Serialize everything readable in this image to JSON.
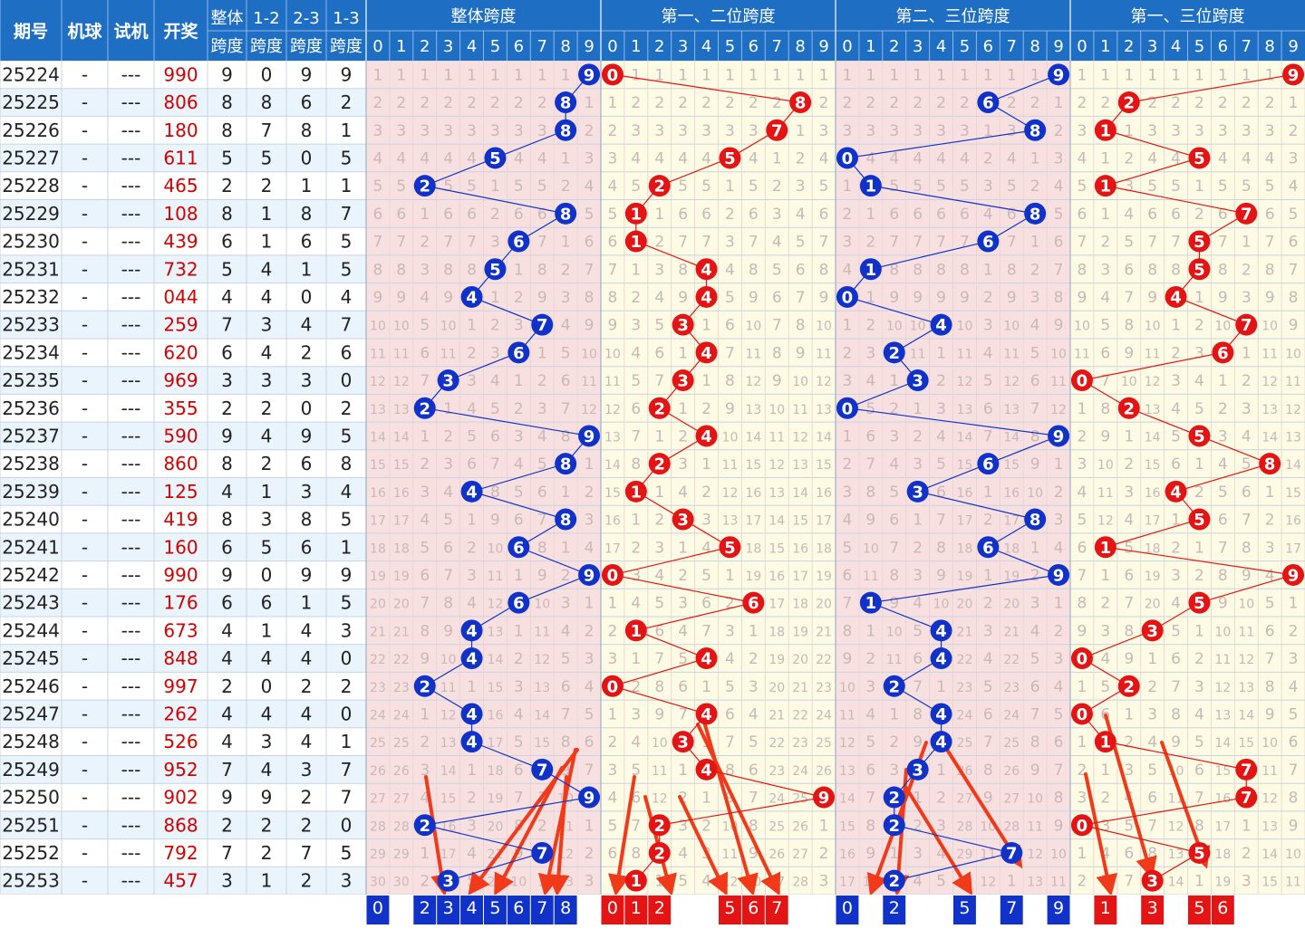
{
  "header": {
    "period": "期号",
    "machine": "机球",
    "test": "试机",
    "draw": "开奖",
    "overall_span": [
      "整体",
      "跨度"
    ],
    "span12": [
      "1-2",
      "跨度"
    ],
    "span23": [
      "2-3",
      "跨度"
    ],
    "span13": [
      "1-3",
      "跨度"
    ],
    "group_titles": [
      "整体跨度",
      "第一、二位跨度",
      "第二、三位跨度",
      "第一、三位跨度"
    ],
    "digits": [
      "0",
      "1",
      "2",
      "3",
      "4",
      "5",
      "6",
      "7",
      "8",
      "9"
    ]
  },
  "colors": {
    "header_bg": "#1e6fc4",
    "row_even": "#ffffff",
    "row_odd": "#eaf4fd",
    "grid_pink": "#f9e0e0",
    "grid_yellow": "#fdfbe4",
    "blue_ball": "#1032c8",
    "red_ball": "#e41414",
    "draw_text": "#d40000",
    "miss_text": "#c8b8b8",
    "arrow": "#f03a1a"
  },
  "chart_data": {
    "type": "table",
    "rows": [
      {
        "period": "25224",
        "machine": "-",
        "test": "---",
        "draw": "990",
        "spans": [
          9,
          0,
          9,
          9
        ]
      },
      {
        "period": "25225",
        "machine": "-",
        "test": "---",
        "draw": "806",
        "spans": [
          8,
          8,
          6,
          2
        ]
      },
      {
        "period": "25226",
        "machine": "-",
        "test": "---",
        "draw": "180",
        "spans": [
          8,
          7,
          8,
          1
        ]
      },
      {
        "period": "25227",
        "machine": "-",
        "test": "---",
        "draw": "611",
        "spans": [
          5,
          5,
          0,
          5
        ]
      },
      {
        "period": "25228",
        "machine": "-",
        "test": "---",
        "draw": "465",
        "spans": [
          2,
          2,
          1,
          1
        ]
      },
      {
        "period": "25229",
        "machine": "-",
        "test": "---",
        "draw": "108",
        "spans": [
          8,
          1,
          8,
          7
        ]
      },
      {
        "period": "25230",
        "machine": "-",
        "test": "---",
        "draw": "439",
        "spans": [
          6,
          1,
          6,
          5
        ]
      },
      {
        "period": "25231",
        "machine": "-",
        "test": "---",
        "draw": "732",
        "spans": [
          5,
          4,
          1,
          5
        ]
      },
      {
        "period": "25232",
        "machine": "-",
        "test": "---",
        "draw": "044",
        "spans": [
          4,
          4,
          0,
          4
        ]
      },
      {
        "period": "25233",
        "machine": "-",
        "test": "---",
        "draw": "259",
        "spans": [
          7,
          3,
          4,
          7
        ]
      },
      {
        "period": "25234",
        "machine": "-",
        "test": "---",
        "draw": "620",
        "spans": [
          6,
          4,
          2,
          6
        ]
      },
      {
        "period": "25235",
        "machine": "-",
        "test": "---",
        "draw": "969",
        "spans": [
          3,
          3,
          3,
          0
        ]
      },
      {
        "period": "25236",
        "machine": "-",
        "test": "---",
        "draw": "355",
        "spans": [
          2,
          2,
          0,
          2
        ]
      },
      {
        "period": "25237",
        "machine": "-",
        "test": "---",
        "draw": "590",
        "spans": [
          9,
          4,
          9,
          5
        ]
      },
      {
        "period": "25238",
        "machine": "-",
        "test": "---",
        "draw": "860",
        "spans": [
          8,
          2,
          6,
          8
        ]
      },
      {
        "period": "25239",
        "machine": "-",
        "test": "---",
        "draw": "125",
        "spans": [
          4,
          1,
          3,
          4
        ]
      },
      {
        "period": "25240",
        "machine": "-",
        "test": "---",
        "draw": "419",
        "spans": [
          8,
          3,
          8,
          5
        ]
      },
      {
        "period": "25241",
        "machine": "-",
        "test": "---",
        "draw": "160",
        "spans": [
          6,
          5,
          6,
          1
        ]
      },
      {
        "period": "25242",
        "machine": "-",
        "test": "---",
        "draw": "990",
        "spans": [
          9,
          0,
          9,
          9
        ]
      },
      {
        "period": "25243",
        "machine": "-",
        "test": "---",
        "draw": "176",
        "spans": [
          6,
          6,
          1,
          5
        ]
      },
      {
        "period": "25244",
        "machine": "-",
        "test": "---",
        "draw": "673",
        "spans": [
          4,
          1,
          4,
          3
        ]
      },
      {
        "period": "25245",
        "machine": "-",
        "test": "---",
        "draw": "848",
        "spans": [
          4,
          4,
          4,
          0
        ]
      },
      {
        "period": "25246",
        "machine": "-",
        "test": "---",
        "draw": "997",
        "spans": [
          2,
          0,
          2,
          2
        ]
      },
      {
        "period": "25247",
        "machine": "-",
        "test": "---",
        "draw": "262",
        "spans": [
          4,
          4,
          4,
          0
        ]
      },
      {
        "period": "25248",
        "machine": "-",
        "test": "---",
        "draw": "526",
        "spans": [
          4,
          3,
          4,
          1
        ]
      },
      {
        "period": "25249",
        "machine": "-",
        "test": "---",
        "draw": "952",
        "spans": [
          7,
          4,
          3,
          7
        ]
      },
      {
        "period": "25250",
        "machine": "-",
        "test": "---",
        "draw": "902",
        "spans": [
          9,
          9,
          2,
          7
        ]
      },
      {
        "period": "25251",
        "machine": "-",
        "test": "---",
        "draw": "868",
        "spans": [
          2,
          2,
          2,
          0
        ]
      },
      {
        "period": "25252",
        "machine": "-",
        "test": "---",
        "draw": "792",
        "spans": [
          7,
          2,
          7,
          5
        ]
      },
      {
        "period": "25253",
        "machine": "-",
        "test": "---",
        "draw": "457",
        "spans": [
          3,
          1,
          2,
          3
        ]
      }
    ],
    "prediction_row": [
      [
        0,
        2,
        3,
        4,
        5,
        6,
        7,
        8
      ],
      [
        0,
        1,
        2,
        5,
        6,
        7
      ],
      [
        0,
        2,
        5,
        7,
        9
      ],
      [
        1,
        3,
        5,
        6
      ]
    ]
  }
}
